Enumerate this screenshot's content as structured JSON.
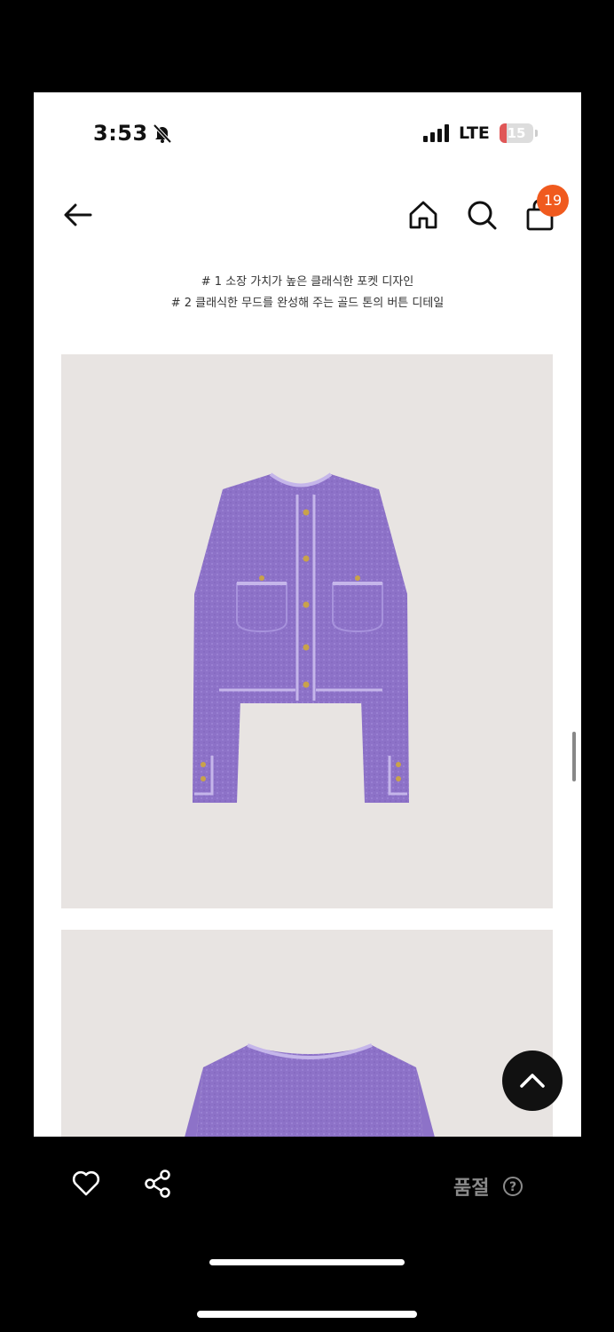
{
  "status_bar": {
    "time": "3:53",
    "network": "LTE",
    "battery_level": "15",
    "icons": [
      "bell-slash-icon",
      "signal-bars-icon",
      "battery-icon"
    ]
  },
  "nav": {
    "icons": [
      "back-arrow-icon",
      "home-icon",
      "search-icon",
      "shopping-bag-icon"
    ],
    "cart_count": "19"
  },
  "description": {
    "line1": "# 1 소장 가치가 높은 클래식한 포켓 디자인",
    "line2": "# 2 클래식한 무드를 완성해 주는 골드 톤의 버튼 디테일"
  },
  "product_images": [
    {
      "subject": "purple knit cardigan, front view",
      "color": "#8d72c8"
    },
    {
      "subject": "purple knit cardigan, detail view (partially visible)",
      "color": "#8d72c8"
    }
  ],
  "colors": {
    "accent_badge": "#f05a1e",
    "photo_background": "#e8e4e2",
    "garment": "#8d72c8",
    "trim": "#c5b6ea",
    "button_gold": "#c9a24a"
  },
  "bottom_bar": {
    "icons": [
      "heart-icon",
      "share-icon",
      "help-circle-icon"
    ],
    "status_text": "품절",
    "help_symbol": "?"
  }
}
